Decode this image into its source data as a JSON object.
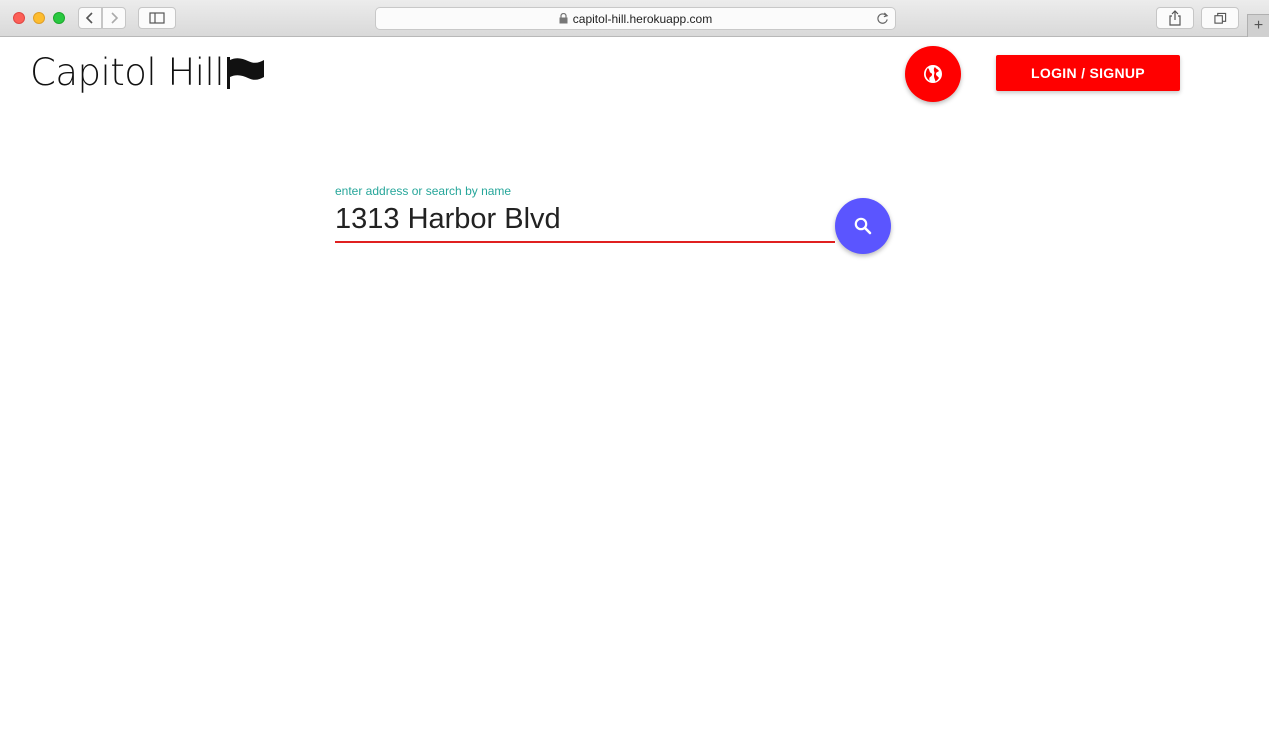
{
  "browser": {
    "url": "capitol-hill.herokuapp.com"
  },
  "header": {
    "logo_text": "Capitol Hill",
    "globe_button_icon": "globe-icon",
    "login_label": "LOGIN / SIGNUP"
  },
  "search": {
    "label": "enter address or search by name",
    "value": "1313 Harbor Blvd",
    "button_icon": "search-icon"
  },
  "colors": {
    "accent_red": "#ff0000",
    "search_button": "#5b55ff",
    "label_teal": "#26a69a"
  }
}
